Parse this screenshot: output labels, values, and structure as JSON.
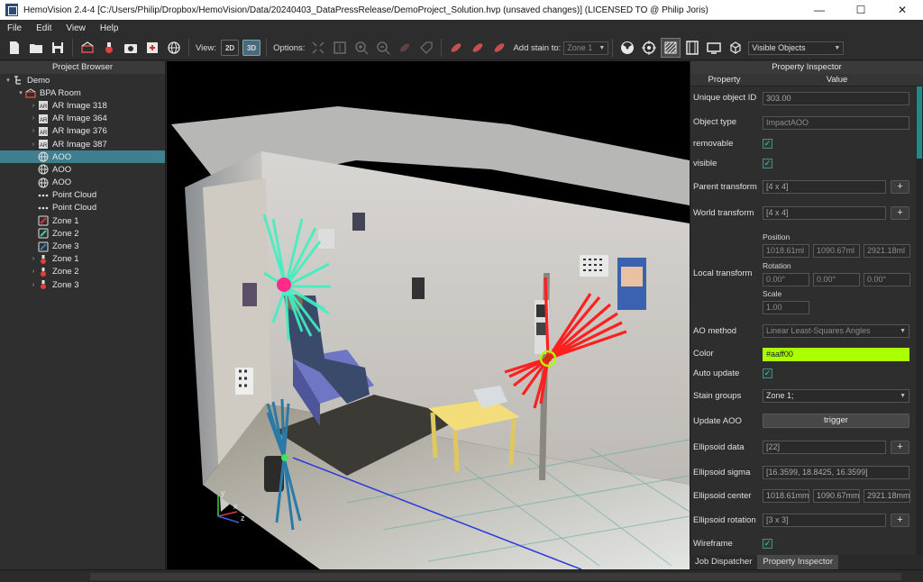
{
  "window": {
    "title": "HemoVision 2.4-4 [C:/Users/Philip/Dropbox/HemoVision/Data/20240403_DataPressRelease/DemoProject_Solution.hvp (unsaved changes)] (LICENSED TO @ Philip Joris)",
    "minimize": "—",
    "maximize": "☐",
    "close": "✕"
  },
  "menu": [
    "File",
    "Edit",
    "View",
    "Help"
  ],
  "toolbar": {
    "view_label": "View:",
    "view_2d": "2D",
    "view_3d": "3D",
    "options_label": "Options:",
    "add_stain_label": "Add stain to:",
    "add_stain_value": "Zone 1",
    "visible_objects": "Visible Objects"
  },
  "browser": {
    "title": "Project Browser",
    "rows": [
      {
        "label": "Demo",
        "icon": "project-tree-icon",
        "twisty": "▾"
      },
      {
        "label": "BPA Room",
        "icon": "room-icon",
        "twisty": "▾"
      },
      {
        "label": "AR Image 318",
        "icon": "ar-image-icon",
        "twisty": "›"
      },
      {
        "label": "AR Image 364",
        "icon": "ar-image-icon",
        "twisty": "›"
      },
      {
        "label": "AR Image 376",
        "icon": "ar-image-icon",
        "twisty": "›"
      },
      {
        "label": "AR Image 387",
        "icon": "ar-image-icon",
        "twisty": "›"
      },
      {
        "label": "AOO",
        "icon": "globe-icon",
        "twisty": ""
      },
      {
        "label": "AOO",
        "icon": "globe-icon",
        "twisty": ""
      },
      {
        "label": "AOO",
        "icon": "globe-icon",
        "twisty": ""
      },
      {
        "label": "Point Cloud",
        "icon": "point-cloud-icon",
        "twisty": ""
      },
      {
        "label": "Point Cloud",
        "icon": "point-cloud-icon",
        "twisty": ""
      },
      {
        "label": "Zone 1",
        "icon": "zone-red-icon",
        "twisty": ""
      },
      {
        "label": "Zone 2",
        "icon": "zone-teal-icon",
        "twisty": ""
      },
      {
        "label": "Zone 3",
        "icon": "zone-blue-icon",
        "twisty": ""
      },
      {
        "label": "Zone 1",
        "icon": "stain-drop-icon",
        "twisty": "›"
      },
      {
        "label": "Zone 2",
        "icon": "stain-drop-icon",
        "twisty": "›"
      },
      {
        "label": "Zone 3",
        "icon": "stain-drop-icon",
        "twisty": "›"
      }
    ],
    "selected_index": 6
  },
  "viewport": {
    "axis_y": "y",
    "axis_x": "x",
    "axis_z": "z"
  },
  "inspector": {
    "title": "Property Inspector",
    "col_property": "Property",
    "col_value": "Value",
    "unique_id_label": "Unique object ID",
    "unique_id_value": "303.00",
    "object_type_label": "Object type",
    "object_type_value": "ImpactAOO",
    "removable_label": "removable",
    "visible_label": "visible",
    "parent_transform_label": "Parent transform",
    "parent_transform_value": "[4 x 4]",
    "world_transform_label": "World transform",
    "world_transform_value": "[4 x 4]",
    "local_transform_label": "Local transform",
    "position_label": "Position",
    "position": [
      "1018.61ml",
      "1090.67ml",
      "2921.18ml"
    ],
    "rotation_label": "Rotation",
    "rotation": [
      "0.00°",
      "0.00°",
      "0.00°"
    ],
    "scale_label": "Scale",
    "scale_value": "1.00",
    "ao_method_label": "AO method",
    "ao_method_value": "Linear Least-Squares Angles",
    "color_label": "Color",
    "color_value": "#aaff00",
    "auto_update_label": "Auto update",
    "stain_groups_label": "Stain groups",
    "stain_groups_value": "Zone 1;",
    "update_aoo_label": "Update AOO",
    "trigger_label": "trigger",
    "ellipsoid_data_label": "Ellipsoid data",
    "ellipsoid_data_value": "[22]",
    "ellipsoid_sigma_label": "Ellipsoid sigma",
    "ellipsoid_sigma_value": "[16.3599, 18.8425, 16.3599]",
    "ellipsoid_center_label": "Ellipsoid center",
    "ellipsoid_center": [
      "1018.61mm",
      "1090.67mm",
      "2921.18mm"
    ],
    "ellipsoid_rotation_label": "Ellipsoid rotation",
    "ellipsoid_rotation_value": "[3 x 3]",
    "wireframe_label": "Wireframe",
    "plus": "+",
    "check": "✓"
  },
  "tabs": [
    "Job Dispatcher",
    "Property Inspector"
  ],
  "colors": {
    "accent": "#3f7f8f",
    "aoo_color": "#aaff00",
    "red_trajectory": "#ff2020",
    "cyan_trajectory": "#40f0c0",
    "blue_trajectory": "#2a7aa8"
  }
}
